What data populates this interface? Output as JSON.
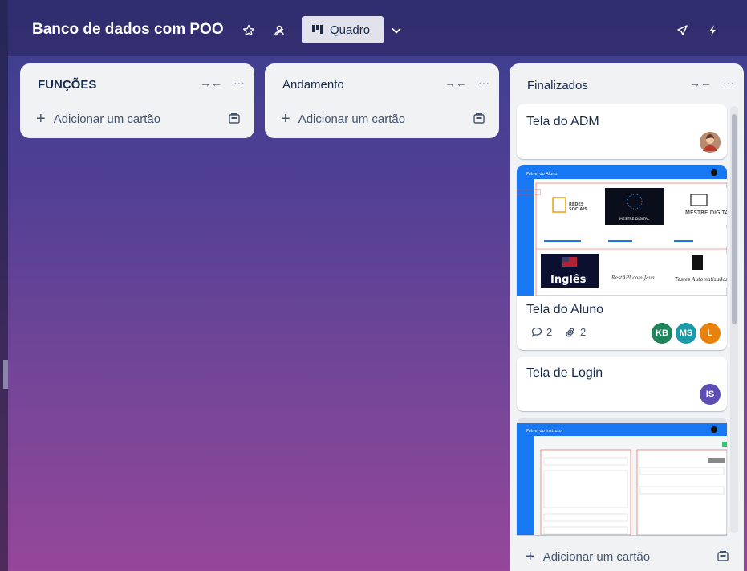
{
  "header": {
    "board_title": "Banco de dados com POO",
    "view_label": "Quadro",
    "star_icon": "star-icon",
    "visibility_icon": "people-icon"
  },
  "lists": [
    {
      "title": "FUNÇÕES",
      "add_card_label": "Adicionar um cartão"
    },
    {
      "title": "Andamento",
      "add_card_label": "Adicionar um cartão"
    },
    {
      "title": "Finalizados",
      "add_card_label": "Adicionar um cartão",
      "cards": [
        {
          "title": "Tela do ADM"
        },
        {
          "title": "Tela do Aluno",
          "comments": "2",
          "attachments": "2",
          "members": [
            "KB",
            "MS",
            "L"
          ],
          "cover": {
            "panel_title": "Painel do Aluno",
            "courses": [
              "REDES SOCIAIS",
              "MESTRE DIGITAL",
              "MESTRE DIGITAL",
              "Inglês",
              "RestAPI com Java",
              "Testes Automatizados"
            ]
          }
        },
        {
          "title": "Tela de Login",
          "members": [
            "IS"
          ]
        },
        {
          "cover": {
            "panel_title": "Painel do Instrutor"
          }
        }
      ]
    }
  ],
  "colors": {
    "kb": "#1f845a",
    "ms": "#1d9aaa",
    "l": "#e9820c",
    "is": "#5e4db2"
  }
}
